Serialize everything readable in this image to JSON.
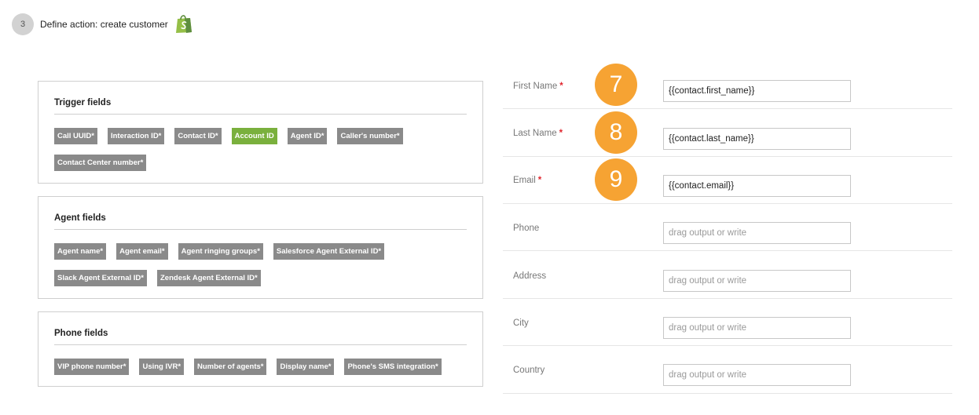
{
  "step": {
    "number": "3",
    "title": "Define action: create customer",
    "icon": "shopify-bag-icon"
  },
  "panels": {
    "trigger": {
      "title": "Trigger fields",
      "tags": [
        "Call UUID*",
        "Interaction ID*",
        "Contact ID*",
        "Account ID",
        "Agent ID*",
        "Caller's number*",
        "Contact Center number*"
      ]
    },
    "agent": {
      "title": "Agent fields",
      "tags": [
        "Agent name*",
        "Agent email*",
        "Agent ringing groups*",
        "Salesforce Agent External ID*",
        "Slack Agent External ID*",
        "Zendesk Agent External ID*"
      ]
    },
    "phone": {
      "title": "Phone fields",
      "tags": [
        "VIP phone number*",
        "Using IVR*",
        "Number of agents*",
        "Display name*",
        "Phone's SMS integration*"
      ]
    }
  },
  "form": {
    "required_mark": "*",
    "fields": [
      {
        "label": "First Name",
        "value": "{{contact.first_name}}",
        "badge": "7"
      },
      {
        "label": "Last Name",
        "value": "{{contact.last_name}}",
        "badge": "8"
      },
      {
        "label": "Email",
        "value": "{{contact.email}}",
        "badge": "9"
      },
      {
        "label": "Phone",
        "placeholder": "drag output or write"
      },
      {
        "label": "Address",
        "placeholder": "drag output or write"
      },
      {
        "label": "City",
        "placeholder": "drag output or write"
      },
      {
        "label": "Country",
        "placeholder": "drag output or write"
      }
    ]
  },
  "colors": {
    "tag_default": "#8a8a8a",
    "tag_active": "#7ab03d",
    "badge": "#f6a333",
    "required": "#e0262f",
    "shopify_green": "#95bf47"
  }
}
